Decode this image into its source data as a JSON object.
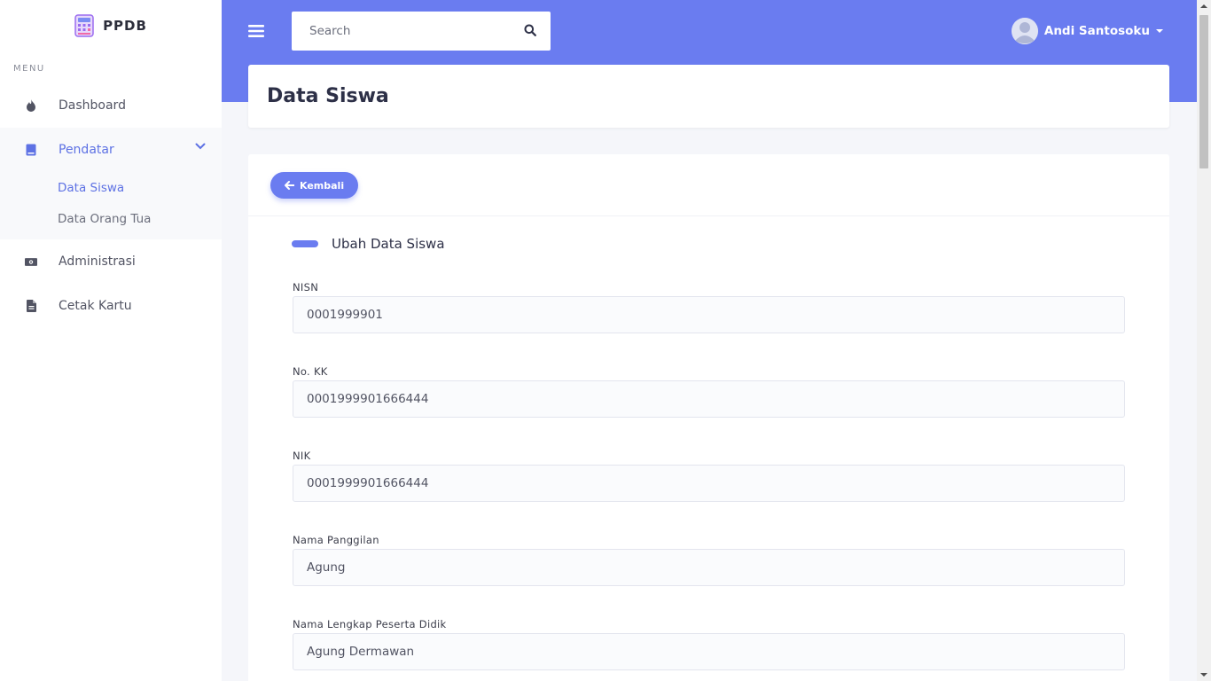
{
  "brand": {
    "name": "PPDB",
    "icon": "calculator-icon"
  },
  "sidebar": {
    "menu_label": "MENU",
    "items": [
      {
        "label": "Dashboard",
        "icon": "fire-icon"
      },
      {
        "label": "Pendatar",
        "icon": "book-icon",
        "expanded": true,
        "children": [
          {
            "label": "Data Siswa",
            "active": true
          },
          {
            "label": "Data Orang Tua"
          }
        ]
      },
      {
        "label": "Administrasi",
        "icon": "money-icon"
      },
      {
        "label": "Cetak Kartu",
        "icon": "file-icon"
      }
    ]
  },
  "header": {
    "search_placeholder": "Search",
    "user_name": "Andi Santosoku"
  },
  "page": {
    "title": "Data Siswa"
  },
  "form": {
    "back_label": "Kembali",
    "section_title": "Ubah Data Siswa",
    "fields": [
      {
        "label": "NISN",
        "value": "0001999901"
      },
      {
        "label": "No. KK",
        "value": "0001999901666444"
      },
      {
        "label": "NIK",
        "value": "0001999901666444"
      },
      {
        "label": "Nama Panggilan",
        "value": "Agung"
      },
      {
        "label": "Nama Lengkap Peserta Didik",
        "value": "Agung Dermawan"
      }
    ]
  },
  "colors": {
    "accent": "#6a7cf0",
    "active_text": "#5e72e4"
  }
}
